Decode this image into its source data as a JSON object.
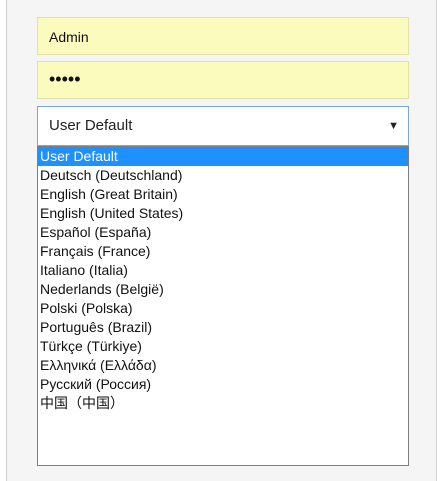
{
  "login": {
    "username_value": "Admin",
    "password_value": "•••••"
  },
  "language_select": {
    "selected": "User Default",
    "arrow_icon": "dropdown-arrow-icon",
    "options": [
      "User Default",
      "Deutsch (Deutschland)",
      "English (Great Britain)",
      "English (United States)",
      "Español (España)",
      "Français (France)",
      "Italiano (Italia)",
      "Nederlands (België)",
      "Polski (Polska)",
      "Português (Brazil)",
      "Türkçe (Türkiye)",
      "Ελληνικά (Ελλάδα)",
      "Русский (Россия)",
      "中国（中国）"
    ]
  },
  "colors": {
    "input_bg": "#fbfbbd",
    "highlight": "#1e90ff",
    "select_border": "#7aa7d8"
  }
}
